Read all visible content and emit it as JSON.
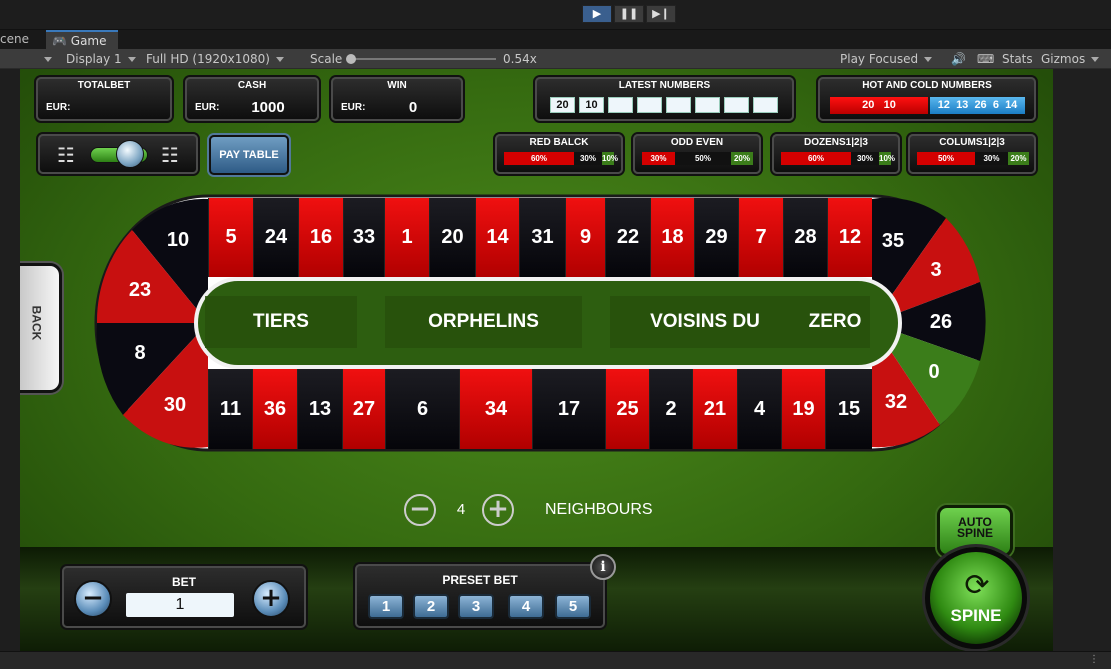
{
  "editor": {
    "play_icon": "play-icon",
    "pause_icon": "pause-icon",
    "step_icon": "step-icon",
    "tabs": [
      {
        "label": "cene"
      },
      {
        "label": "Game"
      }
    ],
    "display": "Display 1",
    "resolution": "Full HD (1920x1080)",
    "scale_label": "Scale",
    "scale_value": "0.54x",
    "scale_fraction": 0.0,
    "play_mode": "Play Focused",
    "stats": "Stats",
    "gizmos": "Gizmos"
  },
  "header": {
    "totalbet": {
      "title": "TOTALBET",
      "currency": "EUR:",
      "value": ""
    },
    "cash": {
      "title": "CASH",
      "currency": "EUR:",
      "value": "1000"
    },
    "win": {
      "title": "WIN",
      "currency": "EUR:",
      "value": "0"
    },
    "latest": {
      "title": "LATEST NUMBERS",
      "numbers": [
        "20",
        "10",
        "",
        "",
        "",
        "",
        "",
        ""
      ]
    },
    "hotcold": {
      "title": "HOT AND COLD NUMBERS",
      "hot": [
        "20",
        "10"
      ],
      "cold": [
        "12",
        "13",
        "26",
        "6",
        "14"
      ]
    },
    "pay_table": "PAY TABLE"
  },
  "stats": [
    {
      "title": "RED BALCK",
      "a": "60%",
      "b": "30%",
      "c": "10%"
    },
    {
      "title": "ODD EVEN",
      "a": "30%",
      "b": "50%",
      "c": "20%"
    },
    {
      "title": "DOZENS1|2|3",
      "a": "60%",
      "b": "30%",
      "c": "10%"
    },
    {
      "title": "COLUMS1|2|3",
      "a": "50%",
      "b": "30%",
      "c": "20%"
    }
  ],
  "board": {
    "top": [
      {
        "n": "5",
        "c": "red"
      },
      {
        "n": "24",
        "c": "black"
      },
      {
        "n": "16",
        "c": "red"
      },
      {
        "n": "33",
        "c": "black"
      },
      {
        "n": "1",
        "c": "red"
      },
      {
        "n": "20",
        "c": "black"
      },
      {
        "n": "14",
        "c": "red"
      },
      {
        "n": "31",
        "c": "black"
      },
      {
        "n": "9",
        "c": "red"
      },
      {
        "n": "22",
        "c": "black"
      },
      {
        "n": "18",
        "c": "red"
      },
      {
        "n": "29",
        "c": "black"
      },
      {
        "n": "7",
        "c": "red"
      },
      {
        "n": "28",
        "c": "black"
      },
      {
        "n": "12",
        "c": "red"
      }
    ],
    "bottom": [
      {
        "n": "11",
        "c": "black"
      },
      {
        "n": "36",
        "c": "red"
      },
      {
        "n": "13",
        "c": "black"
      },
      {
        "n": "27",
        "c": "red"
      },
      {
        "n": "6",
        "c": "black"
      },
      {
        "n": "34",
        "c": "red"
      },
      {
        "n": "17",
        "c": "black"
      },
      {
        "n": "25",
        "c": "red"
      },
      {
        "n": "2",
        "c": "black"
      },
      {
        "n": "21",
        "c": "red"
      },
      {
        "n": "4",
        "c": "black"
      },
      {
        "n": "19",
        "c": "red"
      },
      {
        "n": "15",
        "c": "black"
      }
    ],
    "left_arc": [
      "10",
      "23",
      "8",
      "30"
    ],
    "right_arc": [
      "35",
      "3",
      "26",
      "0",
      "32"
    ],
    "sections": [
      "TIERS",
      "ORPHELINS",
      "VOISINS DU",
      "ZERO"
    ]
  },
  "neighbours": {
    "value": "4",
    "label": "NEIGHBOURS"
  },
  "back_label": "BACK",
  "bet": {
    "title": "BET",
    "value": "1"
  },
  "preset": {
    "title": "PRESET BET",
    "values": [
      "1",
      "2",
      "3",
      "4",
      "5"
    ],
    "info": "i"
  },
  "auto_spin": "AUTO SPINE",
  "spin": "SPINE",
  "colors": {
    "red": "#d40000",
    "black": "#0a0a10",
    "green": "#3b7d1a",
    "felt": "#3e7a16"
  }
}
